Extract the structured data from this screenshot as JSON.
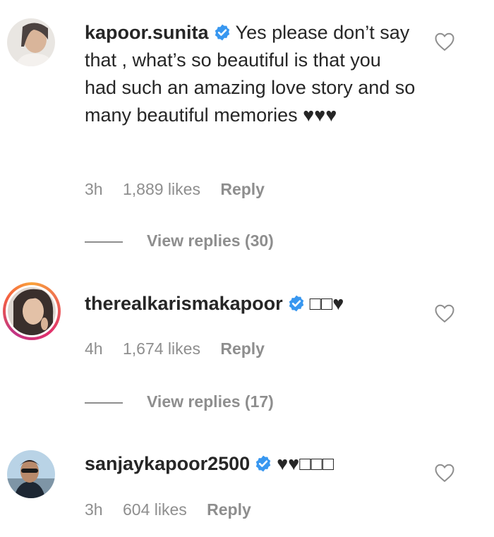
{
  "comments": [
    {
      "username": "kapoor.sunita",
      "text": "Yes please don’t say that , what’s so beautiful is that you had such an amazing love story and so many beautiful memories ♥♥♥",
      "time": "3h",
      "likes": "1,889 likes",
      "reply": "Reply",
      "view_replies": "View replies (30)"
    },
    {
      "username": "therealkarismakapoor",
      "text": "□□♥",
      "time": "4h",
      "likes": "1,674 likes",
      "reply": "Reply",
      "view_replies": "View replies (17)"
    },
    {
      "username": "sanjaykapoor2500",
      "text": "♥♥□□□",
      "time": "3h",
      "likes": "604 likes",
      "reply": "Reply"
    }
  ],
  "colors": {
    "verified": "#3897f0",
    "muted": "#8e8e8e",
    "text": "#262626"
  }
}
